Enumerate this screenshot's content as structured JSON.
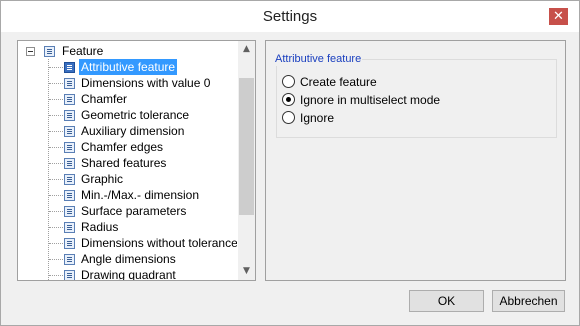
{
  "window": {
    "title": "Settings",
    "close_glyph": "✕"
  },
  "tree": {
    "root_label": "Feature",
    "items": [
      {
        "label": "Attributive feature",
        "selected": true
      },
      {
        "label": "Dimensions with value 0"
      },
      {
        "label": "Chamfer"
      },
      {
        "label": "Geometric tolerance"
      },
      {
        "label": "Auxiliary dimension"
      },
      {
        "label": "Chamfer edges"
      },
      {
        "label": "Shared features"
      },
      {
        "label": "Graphic"
      },
      {
        "label": "Min.-/Max.- dimension"
      },
      {
        "label": "Surface parameters"
      },
      {
        "label": "Radius"
      },
      {
        "label": "Dimensions without tolerance"
      },
      {
        "label": "Angle dimensions"
      },
      {
        "label": "Drawing quadrant"
      }
    ],
    "scroll_up_glyph": "▲",
    "scroll_down_glyph": "▼"
  },
  "panel": {
    "group_title": "Attributive feature",
    "options": [
      {
        "label": "Create feature",
        "checked": false
      },
      {
        "label": "Ignore in multiselect mode",
        "checked": true
      },
      {
        "label": "Ignore",
        "checked": false
      }
    ]
  },
  "buttons": {
    "ok": "OK",
    "cancel": "Abbrechen"
  },
  "colors": {
    "selection": "#3399ff",
    "group_title": "#1a3fbf",
    "close_button": "#c7504a"
  }
}
